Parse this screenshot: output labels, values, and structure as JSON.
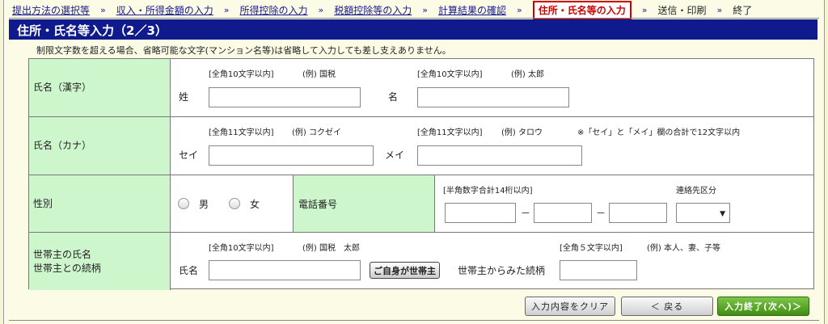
{
  "breadcrumb": {
    "items": [
      "提出方法の選択等",
      "収入・所得金額の入力",
      "所得控除の入力",
      "税額控除等の入力",
      "計算結果の確認"
    ],
    "current": "住所・氏名等の入力",
    "next": [
      "送信・印刷",
      "終了"
    ],
    "separator": "»"
  },
  "title": "住所・氏名等入力（2／3）",
  "notice": "制限文字数を超える場合、省略可能な文字(マンション名等)は省略して入力しても差し支えありません。",
  "name_kanji": {
    "label": "氏名（漢字）",
    "sei_hint": "[全角10文字以内]",
    "sei_example": "(例) 国税",
    "sei_label": "姓",
    "mei_hint": "[全角10文字以内]",
    "mei_example": "(例) 太郎",
    "mei_label": "名"
  },
  "name_kana": {
    "label": "氏名（カナ）",
    "sei_hint": "[全角11文字以内]",
    "sei_example": "(例) コクゼイ",
    "sei_label": "セイ",
    "mei_hint": "[全角11文字以内]",
    "mei_example": "(例) タロウ",
    "note": "※「セイ」と「メイ」欄の合計で12文字以内",
    "mei_label": "メイ"
  },
  "gender": {
    "label": "性別",
    "male": "男",
    "female": "女"
  },
  "phone": {
    "label": "電話番号",
    "hint": "[半角数字合計14桁以内]",
    "dash": "－",
    "contact_label": "連絡先区分"
  },
  "household": {
    "label_line1": "世帯主の氏名",
    "label_line2": "世帯主との続柄",
    "name_hint": "[全角10文字以内]",
    "name_example": "(例) 国税　太郎",
    "name_label": "氏名",
    "self_button": "ご自身が世帯主",
    "relation_hint": "[全角５文字以内]",
    "relation_example": "(例) 本人、妻、子等",
    "relation_label": "世帯主からみた続柄"
  },
  "buttons": {
    "clear": "入力内容をクリア",
    "back": "＜ 戻る",
    "next": "入力終了(次へ)＞"
  }
}
